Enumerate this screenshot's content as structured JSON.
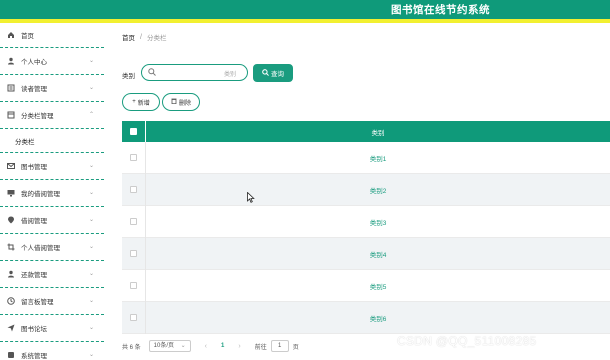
{
  "header": {
    "title": "图书馆在线节约系统"
  },
  "sidebar": {
    "items": [
      {
        "label": "首页",
        "icon": "home-icon"
      },
      {
        "label": "个人中心",
        "icon": "user-icon"
      },
      {
        "label": "读者管理",
        "icon": "reader-icon"
      },
      {
        "label": "分类栏管理",
        "icon": "category-icon"
      },
      {
        "label": "分类栏",
        "sub": true
      },
      {
        "label": "图书管理",
        "icon": "mail-icon"
      },
      {
        "label": "我的借阅管理",
        "icon": "monitor-icon"
      },
      {
        "label": "借阅管理",
        "icon": "pin-icon"
      },
      {
        "label": "个人借阅管理",
        "icon": "crop-icon"
      },
      {
        "label": "还款管理",
        "icon": "user-icon"
      },
      {
        "label": "留言板管理",
        "icon": "clock-icon"
      },
      {
        "label": "图书论坛",
        "icon": "send-icon"
      },
      {
        "label": "系统管理",
        "icon": "settings-icon"
      }
    ]
  },
  "breadcrumb": {
    "home": "首页",
    "separator": "/",
    "current": "分类栏"
  },
  "search": {
    "label": "类别",
    "placeholder": "类别",
    "button": "查询"
  },
  "actions": {
    "add": "新增",
    "delete": "删除"
  },
  "table": {
    "column": "类别",
    "rows": [
      "类别1",
      "类别2",
      "类别3",
      "类别4",
      "类别5",
      "类别6"
    ]
  },
  "pagination": {
    "total": "共 6 条",
    "page_size": "10条/页",
    "current_page": "1",
    "goto_label": "前往",
    "goto_value": "1",
    "page_suffix": "页"
  },
  "watermark": "CSDN @QQ_511008285",
  "colors": {
    "primary": "#0f9a7a",
    "accent_bar": "#f2f030"
  }
}
